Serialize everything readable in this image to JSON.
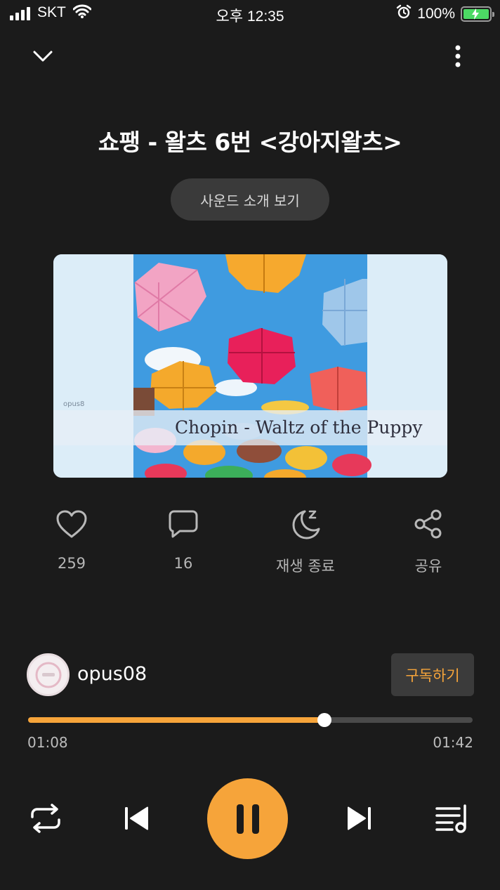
{
  "status_bar": {
    "carrier": "SKT",
    "time": "오후 12:35",
    "battery": "100%"
  },
  "track": {
    "title": "쇼팽 - 왈츠 6번 <강아지왈츠>",
    "intro_button": "사운드 소개 보기",
    "album_art": {
      "caption": "Chopin - Waltz of the Puppy",
      "watermark": "opus8"
    }
  },
  "actions": {
    "like_count": "259",
    "comment_count": "16",
    "sleep_timer_label": "재생 종료",
    "share_label": "공유"
  },
  "artist": {
    "name": "opus08",
    "subscribe_label": "구독하기"
  },
  "progress": {
    "current": "01:08",
    "duration": "01:42",
    "fraction": 0.667
  },
  "colors": {
    "accent": "#f6a43a",
    "background": "#1b1b1b",
    "track": "#4a4a4a"
  },
  "icons": {
    "header": [
      "chevron-down-icon",
      "more-vertical-icon"
    ],
    "actions": [
      "heart-icon",
      "comment-icon",
      "moon-sleep-icon",
      "share-icon"
    ],
    "controls": [
      "repeat-icon",
      "previous-icon",
      "pause-icon",
      "next-icon",
      "playlist-icon"
    ]
  }
}
